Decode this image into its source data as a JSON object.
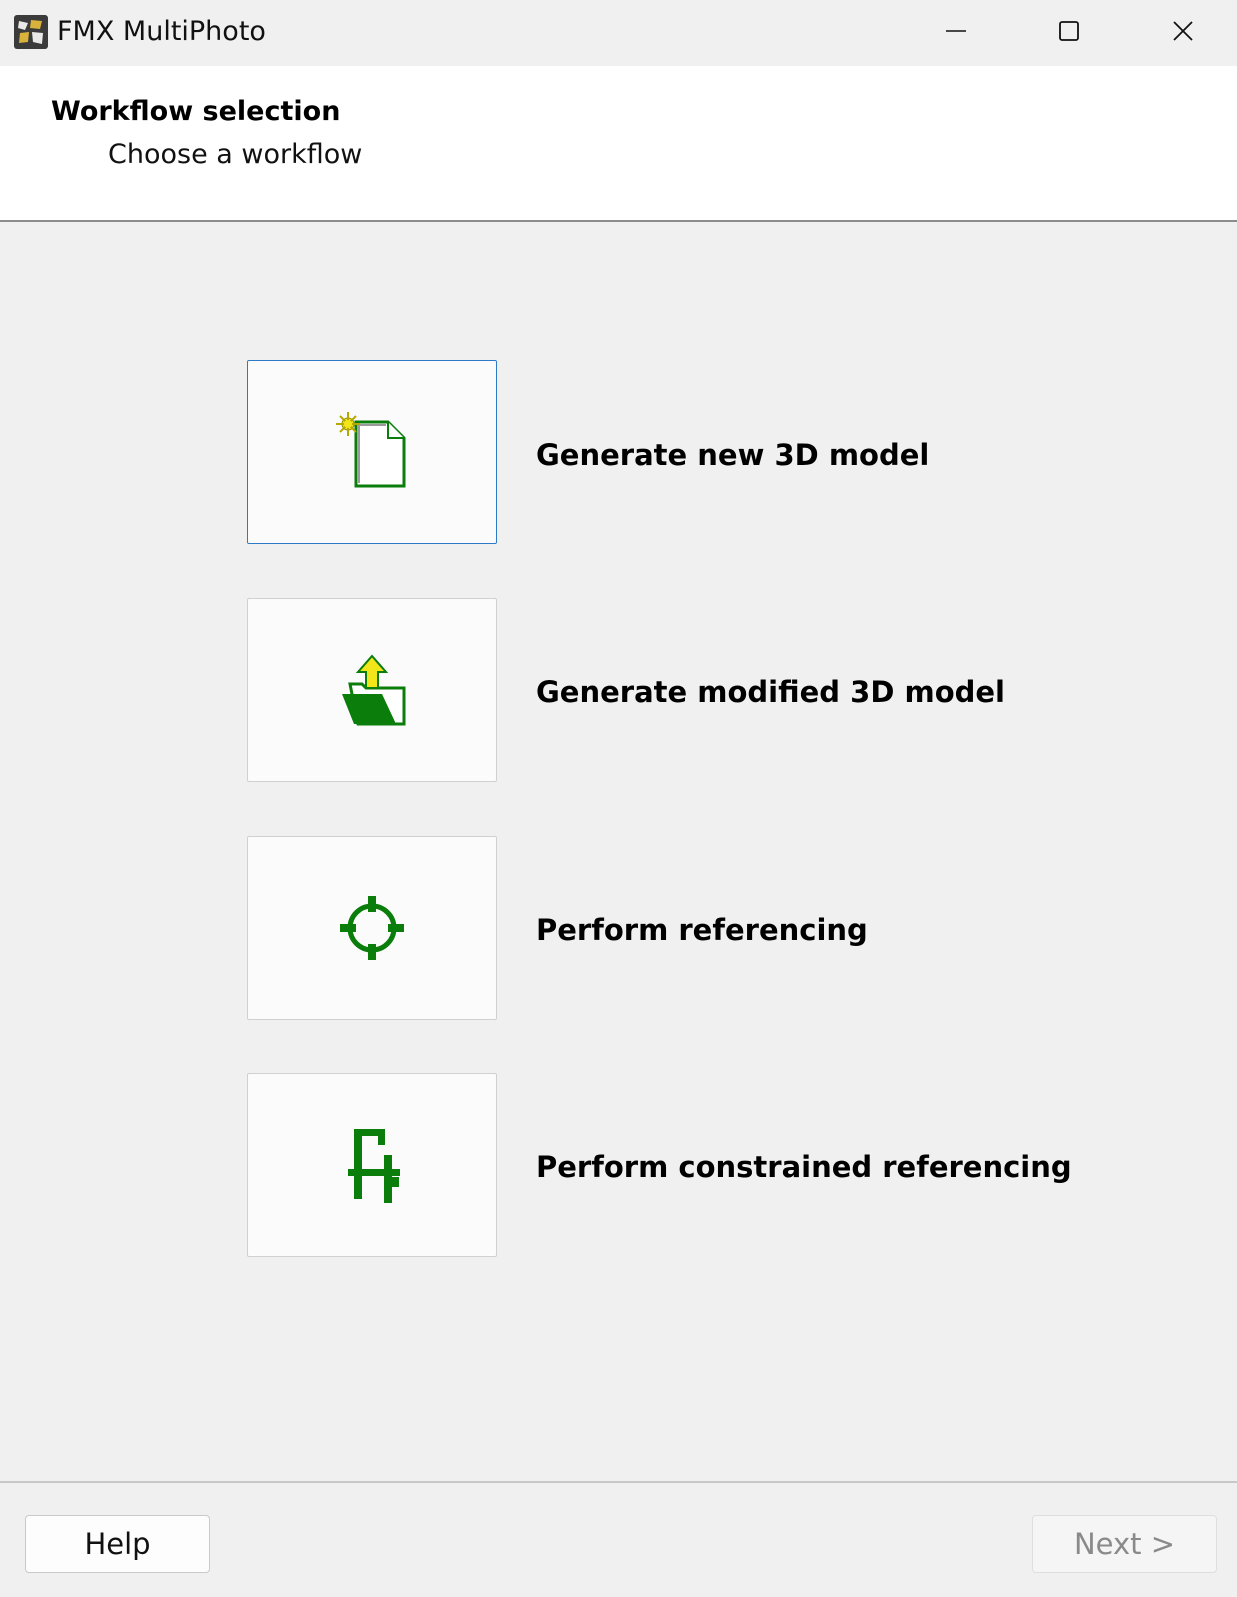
{
  "window": {
    "title": "FMX MultiPhoto"
  },
  "header": {
    "title": "Workflow selection",
    "subtitle": "Choose a workflow"
  },
  "workflows": [
    {
      "label": "Generate new 3D model",
      "icon": "new-document-icon",
      "selected": true
    },
    {
      "label": "Generate modified 3D model",
      "icon": "open-folder-icon",
      "selected": false
    },
    {
      "label": "Perform referencing",
      "icon": "crosshair-target-icon",
      "selected": false
    },
    {
      "label": "Perform constrained referencing",
      "icon": "constraint-clamp-icon",
      "selected": false
    }
  ],
  "footer": {
    "help_label": "Help",
    "next_label": "Next >"
  },
  "colors": {
    "icon_green": "#0a7d0a",
    "icon_yellow": "#f2e51a",
    "selection_border": "#2d7ac7"
  }
}
